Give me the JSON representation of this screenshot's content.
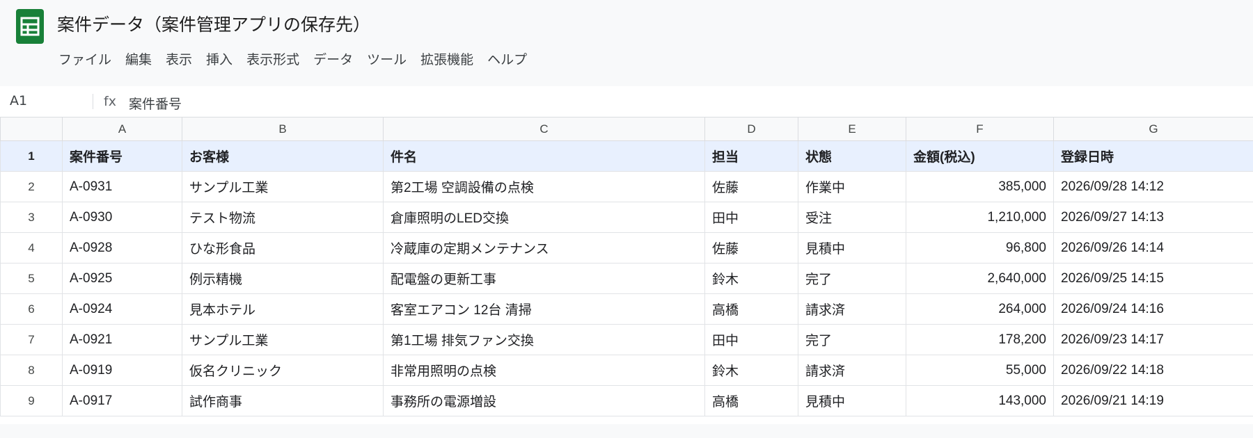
{
  "app": {
    "title": "案件データ（案件管理アプリの保存先）",
    "brand_color": "#188038",
    "icon": "sheets-icon"
  },
  "menu": [
    "ファイル",
    "編集",
    "表示",
    "挿入",
    "表示形式",
    "データ",
    "ツール",
    "拡張機能",
    "ヘルプ"
  ],
  "formula_bar": {
    "cell_ref": "A1",
    "fx_label": "fx",
    "value": "案件番号"
  },
  "grid": {
    "column_letters": [
      "A",
      "B",
      "C",
      "D",
      "E",
      "F",
      "G"
    ],
    "header_row_number": "1",
    "headers": [
      "案件番号",
      "お客様",
      "件名",
      "担当",
      "状態",
      "金額(税込)",
      "登録日時"
    ],
    "rows": [
      {
        "n": "2",
        "cells": [
          "A-0931",
          "サンプル工業",
          "第2工場 空調設備の点検",
          "佐藤",
          "作業中",
          "385,000",
          "2026/09/28 14:12"
        ]
      },
      {
        "n": "3",
        "cells": [
          "A-0930",
          "テスト物流",
          "倉庫照明のLED交換",
          "田中",
          "受注",
          "1,210,000",
          "2026/09/27 14:13"
        ]
      },
      {
        "n": "4",
        "cells": [
          "A-0928",
          "ひな形食品",
          "冷蔵庫の定期メンテナンス",
          "佐藤",
          "見積中",
          "96,800",
          "2026/09/26 14:14"
        ]
      },
      {
        "n": "5",
        "cells": [
          "A-0925",
          "例示精機",
          "配電盤の更新工事",
          "鈴木",
          "完了",
          "2,640,000",
          "2026/09/25 14:15"
        ]
      },
      {
        "n": "6",
        "cells": [
          "A-0924",
          "見本ホテル",
          "客室エアコン 12台 清掃",
          "高橋",
          "請求済",
          "264,000",
          "2026/09/24 14:16"
        ]
      },
      {
        "n": "7",
        "cells": [
          "A-0921",
          "サンプル工業",
          "第1工場 排気ファン交換",
          "田中",
          "完了",
          "178,200",
          "2026/09/23 14:17"
        ]
      },
      {
        "n": "8",
        "cells": [
          "A-0919",
          "仮名クリニック",
          "非常用照明の点検",
          "鈴木",
          "請求済",
          "55,000",
          "2026/09/22 14:18"
        ]
      },
      {
        "n": "9",
        "cells": [
          "A-0917",
          "試作商事",
          "事務所の電源増設",
          "高橋",
          "見積中",
          "143,000",
          "2026/09/21 14:19"
        ]
      }
    ]
  }
}
